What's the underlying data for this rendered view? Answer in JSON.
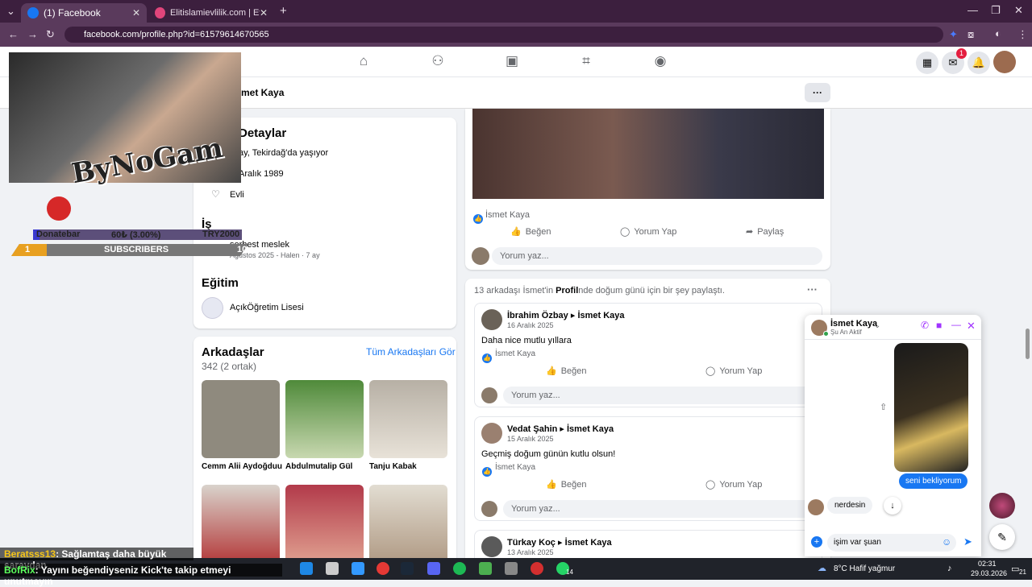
{
  "browser": {
    "tabs": [
      {
        "label": "(1) Facebook",
        "active": true
      },
      {
        "label": "Elitislamievlilik.com | Evlilik Siter",
        "active": false
      }
    ],
    "new_tab": "+",
    "url": "facebook.com/profile.php?id=61579614670565"
  },
  "fb": {
    "messenger_badge": "1",
    "profile_name": "İsmet Kaya",
    "more_label": "···"
  },
  "details": {
    "title": "Detaylar",
    "lives": "ay, Tekirdağ'da yaşıyor",
    "birthday": "Aralık 1989",
    "relationship": "Evli",
    "work_title": "İş",
    "job": "serbest meslek",
    "job_meta": "Ağustos 2025 - Halen · 7 ay",
    "edu_title": "Eğitim",
    "school": "AçıkÖğretim Lisesi"
  },
  "friends": {
    "title": "Arkadaşlar",
    "count": "342 (2 ortak)",
    "see_all": "Tüm Arkadaşları Gör",
    "list": [
      {
        "name": "Cemm Alii Aydoğduu",
        "color": "#8f8a7e"
      },
      {
        "name": "Abdulmutalip Gül",
        "color": "#5e8c4a"
      },
      {
        "name": "Tanju Kabak",
        "color": "#c9c2b8"
      },
      {
        "name": "",
        "color": "#b43a3a"
      },
      {
        "name": "",
        "color": "#c77c6a"
      },
      {
        "name": "",
        "color": "#d0c7b8"
      }
    ]
  },
  "post1": {
    "liker": "İsmet Kaya",
    "like": "Beğen",
    "comment": "Yorum Yap",
    "share": "Paylaş",
    "comment_placeholder": "Yorum yaz..."
  },
  "birthday_block": {
    "header_pre": "13 arkadaşı İsmet'in ",
    "header_bold": "Profil",
    "header_post": "nde doğum günü için bir şey paylaştı.",
    "posts": [
      {
        "author": "İbrahim Özbay",
        "target": "İsmet Kaya",
        "date": "16 Aralık 2025",
        "text": "Daha nice mutlu yıllara",
        "liker": "İsmet Kaya"
      },
      {
        "author": "Vedat Şahin",
        "target": "İsmet Kaya",
        "date": "15 Aralık 2025",
        "text": "Geçmiş doğum günün kutlu olsun!",
        "liker": "İsmet Kaya"
      },
      {
        "author": "Türkay Koç",
        "target": "İsmet Kaya",
        "date": "13 Aralık 2025",
        "text": "",
        "liker": ""
      }
    ],
    "like": "Beğen",
    "comment": "Yorum Yap",
    "comment_placeholder": "Yorum yaz..."
  },
  "chat": {
    "name": "İsmet Kaya",
    "status": "Şu An Aktif",
    "sent_msg": "seni bekliyorum",
    "recv_msg": "nerdesin",
    "input_value": "işim var şuan"
  },
  "stream": {
    "logo": "ByNoGam",
    "donate_label": "Donatebar",
    "donate_progress": "60₺ (3.00%)",
    "donate_goal": "TRY2000",
    "donate_fraction": 0.03,
    "sub_left": "1",
    "sub_label": "SUBSCRIBERS",
    "sub_right": "10",
    "chat1_user": "Beratsss13",
    "chat1_msg": ": Sağlamtaş daha büyük saraydan",
    "chat2_user": "BofRix",
    "chat2_msg": ": Yayını beğendiyseniz Kick'te takip etmeyi unutmayın"
  },
  "taskbar": {
    "weather": "8°C  Hafif yağmur",
    "time": "02:31",
    "date": "29.03.2026",
    "whatsapp_badge": "14",
    "notif": "21"
  },
  "colors": {
    "fb_blue": "#1877f2",
    "chrome_purple": "#5a3a5c",
    "messenger_purple": "#a033ff"
  }
}
